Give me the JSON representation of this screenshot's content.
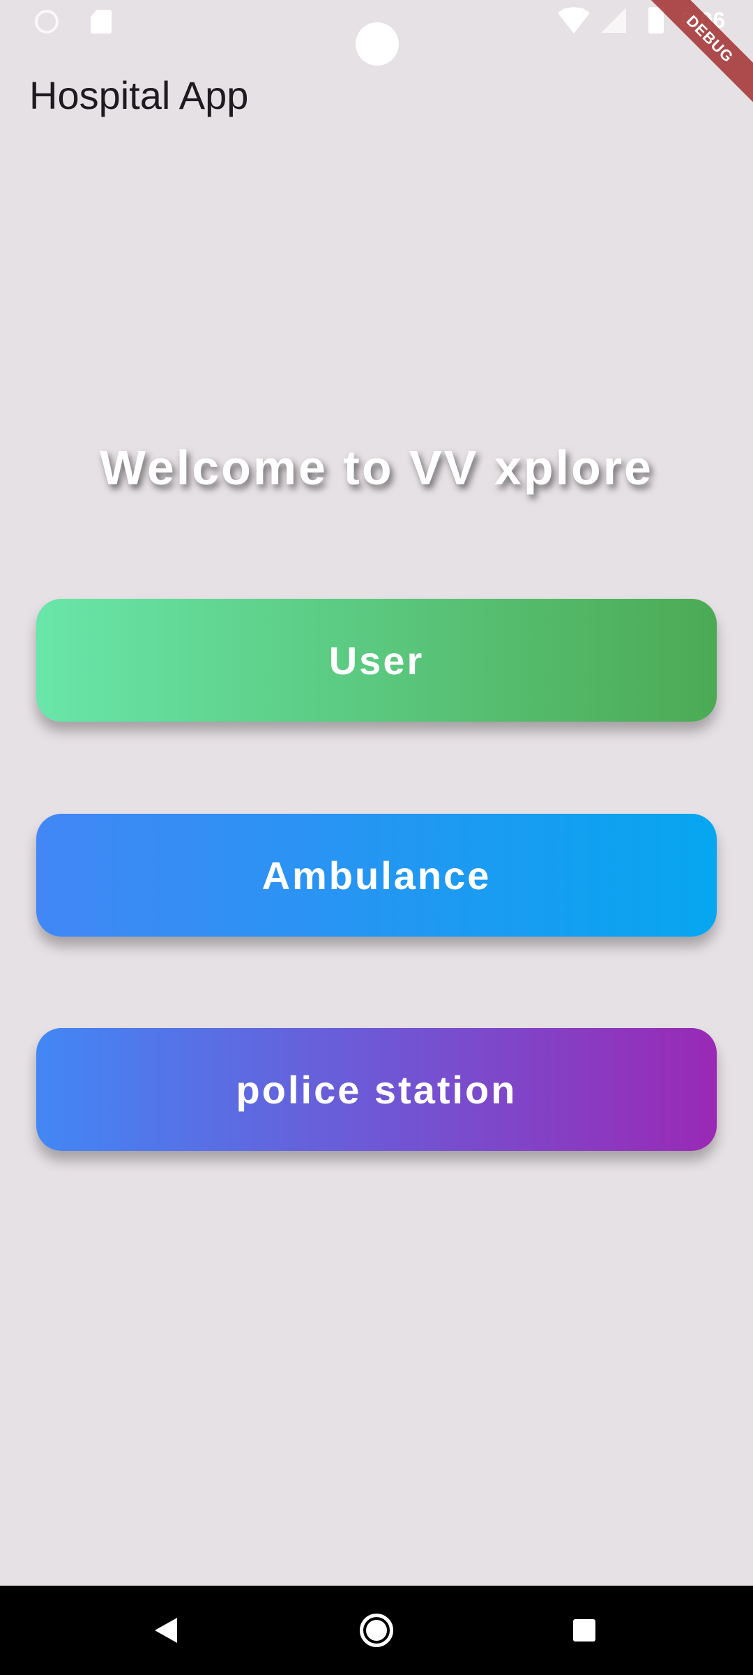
{
  "status_bar": {
    "time": "8:06",
    "icons": [
      "notification-dot-icon",
      "sd-card-icon",
      "wifi-icon",
      "cell-signal-icon",
      "battery-icon"
    ]
  },
  "debug_banner": {
    "label": "DEBUG",
    "color": "#a02828"
  },
  "app_bar": {
    "title": "Hospital App"
  },
  "main": {
    "welcome_text": "Welcome to VV xplore",
    "buttons": [
      {
        "label": "User",
        "gradient": [
          "#69e6a9",
          "#4caa54"
        ]
      },
      {
        "label": "Ambulance",
        "gradient": [
          "#4287f5",
          "#06a6f0"
        ]
      },
      {
        "label": "police station",
        "gradient": [
          "#4287f5",
          "#9a29b5"
        ]
      }
    ]
  },
  "nav_bar": {
    "icons": [
      "back-icon",
      "home-icon",
      "recents-icon"
    ]
  },
  "colors": {
    "background": "#e6e1e5",
    "text": "#1d1b20"
  }
}
